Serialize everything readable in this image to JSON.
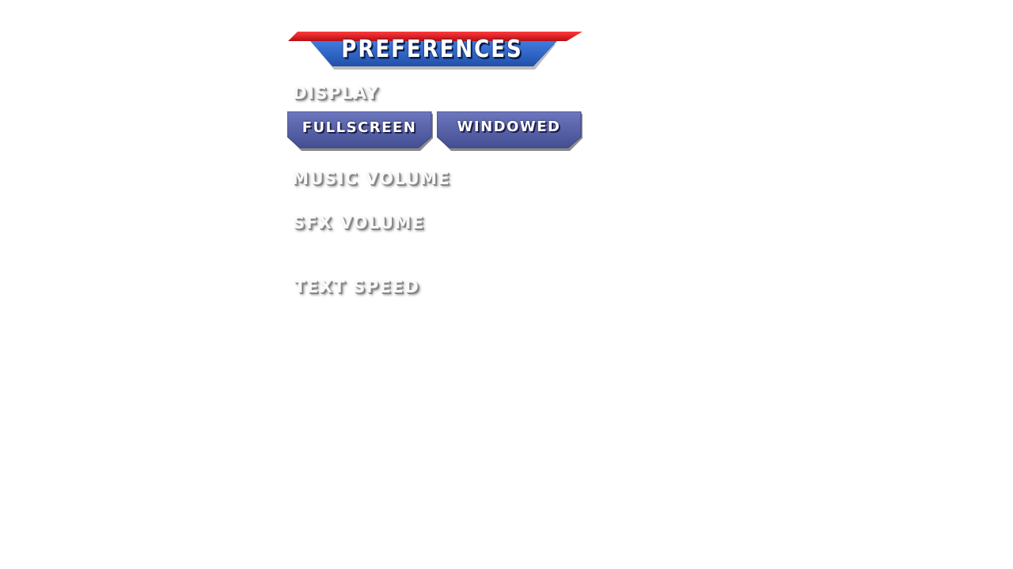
{
  "title": "PREFERENCES",
  "display": {
    "label": "DISPLAY",
    "options": [
      "FULLSCREEN",
      "WINDOWED"
    ]
  },
  "music_volume": {
    "label": "MUSIC VOLUME"
  },
  "sfx_volume": {
    "label": "SFX VOLUME"
  },
  "text_speed": {
    "label": "TEXT SPEED"
  },
  "colors": {
    "title_top_bar": "#d8141c",
    "title_blue": "#2a5fc2",
    "button_blue": "#4f5aa0",
    "label_text": "#fafafa"
  }
}
